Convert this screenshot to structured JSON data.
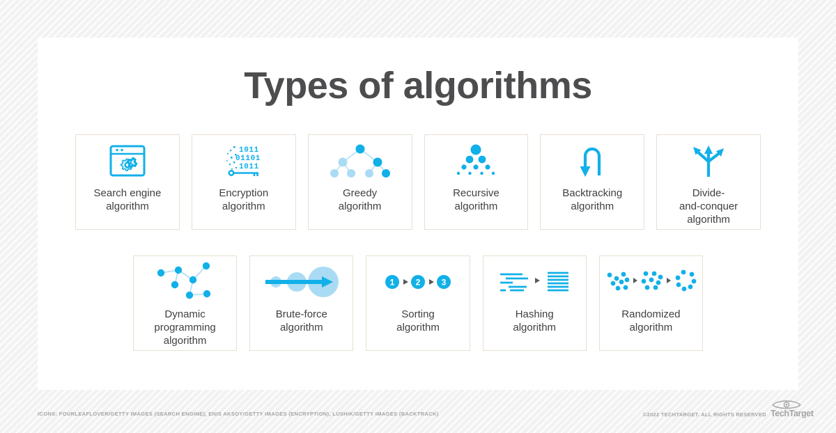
{
  "page": {
    "title": "Types of algorithms",
    "accent_blue": "#12b0e8",
    "accent_light_blue": "#a9dcf4",
    "card_border": "#e6e0d2",
    "text_color": "#414042",
    "title_color": "#4d4d4f",
    "background": "#f2f2f2",
    "panel_background": "#ffffff"
  },
  "rows": [
    {
      "cards": [
        {
          "label": "Search engine\nalgorithm",
          "icon": "browser-gear-icon"
        },
        {
          "label": "Encryption\nalgorithm",
          "icon": "binary-key-icon",
          "binary_rows": [
            "1011",
            "01101",
            "1011"
          ]
        },
        {
          "label": "Greedy\nalgorithm",
          "icon": "binary-tree-icon"
        },
        {
          "label": "Recursive\nalgorithm",
          "icon": "dot-pyramid-icon"
        },
        {
          "label": "Backtracking\nalgorithm",
          "icon": "u-turn-arrow-icon"
        },
        {
          "label": "Divide-\nand-conquer\nalgorithm",
          "icon": "three-way-arrow-icon"
        }
      ]
    },
    {
      "cards": [
        {
          "label": "Dynamic\nprogramming\nalgorithm",
          "icon": "node-network-icon"
        },
        {
          "label": "Brute-force\nalgorithm",
          "icon": "growing-circles-arrow-icon"
        },
        {
          "label": "Sorting\nalgorithm",
          "icon": "numbered-steps-icon",
          "steps": [
            "1",
            "2",
            "3"
          ]
        },
        {
          "label": "Hashing\nalgorithm",
          "icon": "lines-to-lines-icon"
        },
        {
          "label": "Randomized\nalgorithm",
          "icon": "dot-clusters-icon"
        }
      ]
    }
  ],
  "footer": {
    "credits": "ICONS: FOURLEAFLOVER/GETTY IMAGES (SEARCH ENGINE), ENIS AKSOY/GETTY IMAGES (ENCRYPTION), LUSHIK/GETTY IMAGES (BACKTRACK)",
    "copyright": "©2022 TECHTARGET. ALL RIGHTS RESERVED",
    "logo_name": "TechTarget"
  }
}
